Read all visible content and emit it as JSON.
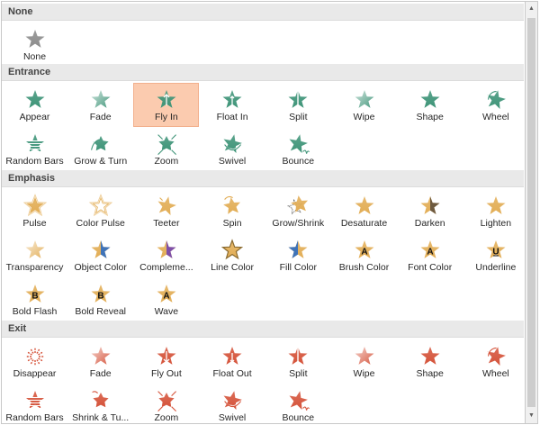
{
  "sections": [
    {
      "key": "none",
      "title": "None",
      "theme": "none",
      "items": [
        {
          "label": "None",
          "icon": "none-star-icon"
        }
      ]
    },
    {
      "key": "entrance",
      "title": "Entrance",
      "theme": "entrance",
      "items": [
        {
          "label": "Appear",
          "icon": "appear-star-icon"
        },
        {
          "label": "Fade",
          "icon": "fade-star-icon"
        },
        {
          "label": "Fly In",
          "icon": "fly-in-star-icon",
          "selected": true
        },
        {
          "label": "Float In",
          "icon": "float-in-star-icon"
        },
        {
          "label": "Split",
          "icon": "split-star-icon"
        },
        {
          "label": "Wipe",
          "icon": "wipe-star-icon"
        },
        {
          "label": "Shape",
          "icon": "shape-star-icon"
        },
        {
          "label": "Wheel",
          "icon": "wheel-star-icon"
        },
        {
          "label": "Random Bars",
          "icon": "random-bars-star-icon"
        },
        {
          "label": "Grow & Turn",
          "icon": "grow-turn-star-icon"
        },
        {
          "label": "Zoom",
          "icon": "zoom-star-icon"
        },
        {
          "label": "Swivel",
          "icon": "swivel-star-icon"
        },
        {
          "label": "Bounce",
          "icon": "bounce-star-icon"
        }
      ]
    },
    {
      "key": "emphasis",
      "title": "Emphasis",
      "theme": "emphasis",
      "items": [
        {
          "label": "Pulse",
          "icon": "pulse-star-icon"
        },
        {
          "label": "Color Pulse",
          "icon": "color-pulse-star-icon"
        },
        {
          "label": "Teeter",
          "icon": "teeter-star-icon"
        },
        {
          "label": "Spin",
          "icon": "spin-star-icon"
        },
        {
          "label": "Grow/Shrink",
          "icon": "grow-shrink-star-icon"
        },
        {
          "label": "Desaturate",
          "icon": "desaturate-star-icon"
        },
        {
          "label": "Darken",
          "icon": "darken-star-icon"
        },
        {
          "label": "Lighten",
          "icon": "lighten-star-icon"
        },
        {
          "label": "Transparency",
          "icon": "transparency-star-icon"
        },
        {
          "label": "Object Color",
          "icon": "object-color-star-icon"
        },
        {
          "label": "Compleme...",
          "icon": "complementary-color-star-icon"
        },
        {
          "label": "Line Color",
          "icon": "line-color-star-icon"
        },
        {
          "label": "Fill Color",
          "icon": "fill-color-star-icon"
        },
        {
          "label": "Brush Color",
          "icon": "brush-color-star-icon",
          "letter": "A"
        },
        {
          "label": "Font Color",
          "icon": "font-color-star-icon",
          "letter": "A"
        },
        {
          "label": "Underline",
          "icon": "underline-star-icon",
          "letter": "U"
        },
        {
          "label": "Bold Flash",
          "icon": "bold-flash-star-icon",
          "letter": "B"
        },
        {
          "label": "Bold Reveal",
          "icon": "bold-reveal-star-icon",
          "letter": "B"
        },
        {
          "label": "Wave",
          "icon": "wave-star-icon",
          "letter": "A"
        }
      ]
    },
    {
      "key": "exit",
      "title": "Exit",
      "theme": "exit",
      "items": [
        {
          "label": "Disappear",
          "icon": "disappear-star-icon"
        },
        {
          "label": "Fade",
          "icon": "fade-out-star-icon"
        },
        {
          "label": "Fly Out",
          "icon": "fly-out-star-icon"
        },
        {
          "label": "Float Out",
          "icon": "float-out-star-icon"
        },
        {
          "label": "Split",
          "icon": "split-out-star-icon"
        },
        {
          "label": "Wipe",
          "icon": "wipe-out-star-icon"
        },
        {
          "label": "Shape",
          "icon": "shape-out-star-icon"
        },
        {
          "label": "Wheel",
          "icon": "wheel-out-star-icon"
        },
        {
          "label": "Random Bars",
          "icon": "random-bars-out-star-icon"
        },
        {
          "label": "Shrink & Tu...",
          "icon": "shrink-turn-star-icon"
        },
        {
          "label": "Zoom",
          "icon": "zoom-out-star-icon"
        },
        {
          "label": "Swivel",
          "icon": "swivel-out-star-icon"
        },
        {
          "label": "Bounce",
          "icon": "bounce-out-star-icon"
        }
      ]
    }
  ],
  "colors": {
    "none": "#8c8c8c",
    "entrance": "#3e9478",
    "emphasis": "#e2ad55",
    "exit": "#d5533a",
    "selected_bg": "#fbcbaf",
    "accent_blue": "#3f73b8",
    "accent_purple": "#7e4fa8",
    "accent_brown": "#6e5a3f"
  }
}
